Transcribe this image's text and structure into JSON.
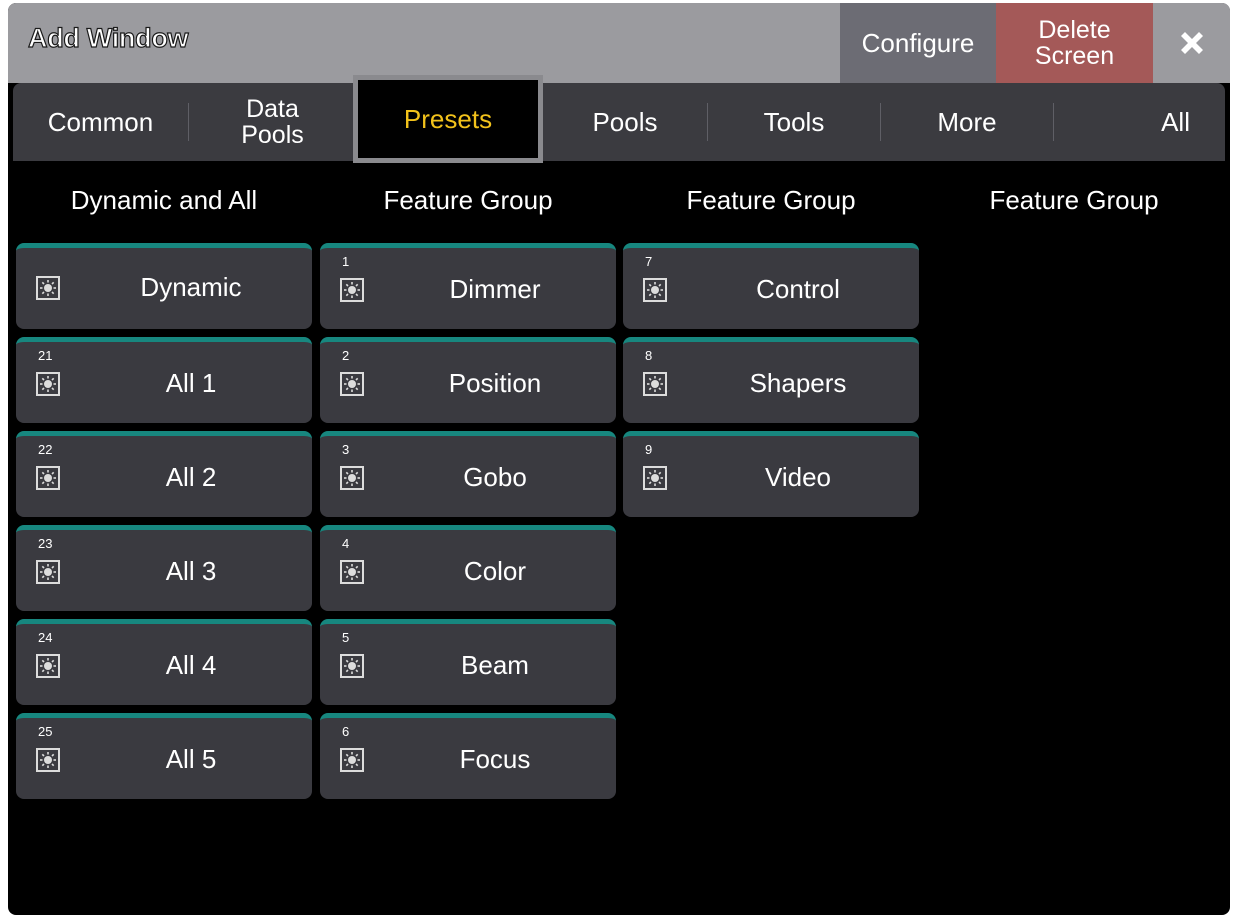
{
  "title": "Add Window",
  "header_buttons": {
    "configure": "Configure",
    "delete": "Delete\nScreen"
  },
  "tabs": [
    {
      "label": "Common",
      "active": false
    },
    {
      "label": "Data\nPools",
      "active": false
    },
    {
      "label": "Presets",
      "active": true
    },
    {
      "label": "Pools",
      "active": false
    },
    {
      "label": "Tools",
      "active": false
    },
    {
      "label": "More",
      "active": false
    },
    {
      "label": "All",
      "active": false
    }
  ],
  "columns": [
    {
      "header": "Dynamic and All",
      "items": [
        {
          "num": "",
          "label": "Dynamic",
          "icon": "preset-icon"
        },
        {
          "num": "21",
          "label": "All 1",
          "icon": "preset-icon"
        },
        {
          "num": "22",
          "label": "All 2",
          "icon": "preset-icon"
        },
        {
          "num": "23",
          "label": "All 3",
          "icon": "preset-icon"
        },
        {
          "num": "24",
          "label": "All 4",
          "icon": "preset-icon"
        },
        {
          "num": "25",
          "label": "All 5",
          "icon": "preset-icon"
        }
      ]
    },
    {
      "header": "Feature Group",
      "items": [
        {
          "num": "1",
          "label": "Dimmer",
          "icon": "preset-icon"
        },
        {
          "num": "2",
          "label": "Position",
          "icon": "preset-icon"
        },
        {
          "num": "3",
          "label": "Gobo",
          "icon": "preset-icon"
        },
        {
          "num": "4",
          "label": "Color",
          "icon": "preset-icon"
        },
        {
          "num": "5",
          "label": "Beam",
          "icon": "preset-icon"
        },
        {
          "num": "6",
          "label": "Focus",
          "icon": "preset-icon"
        }
      ]
    },
    {
      "header": "Feature Group",
      "items": [
        {
          "num": "7",
          "label": "Control",
          "icon": "preset-icon"
        },
        {
          "num": "8",
          "label": "Shapers",
          "icon": "preset-icon"
        },
        {
          "num": "9",
          "label": "Video",
          "icon": "preset-icon"
        }
      ]
    },
    {
      "header": "Feature Group",
      "items": []
    }
  ],
  "colors": {
    "accent_tab_text": "#f2c21b",
    "preset_top_border": "#17877f",
    "delete_button": "#a45958"
  }
}
